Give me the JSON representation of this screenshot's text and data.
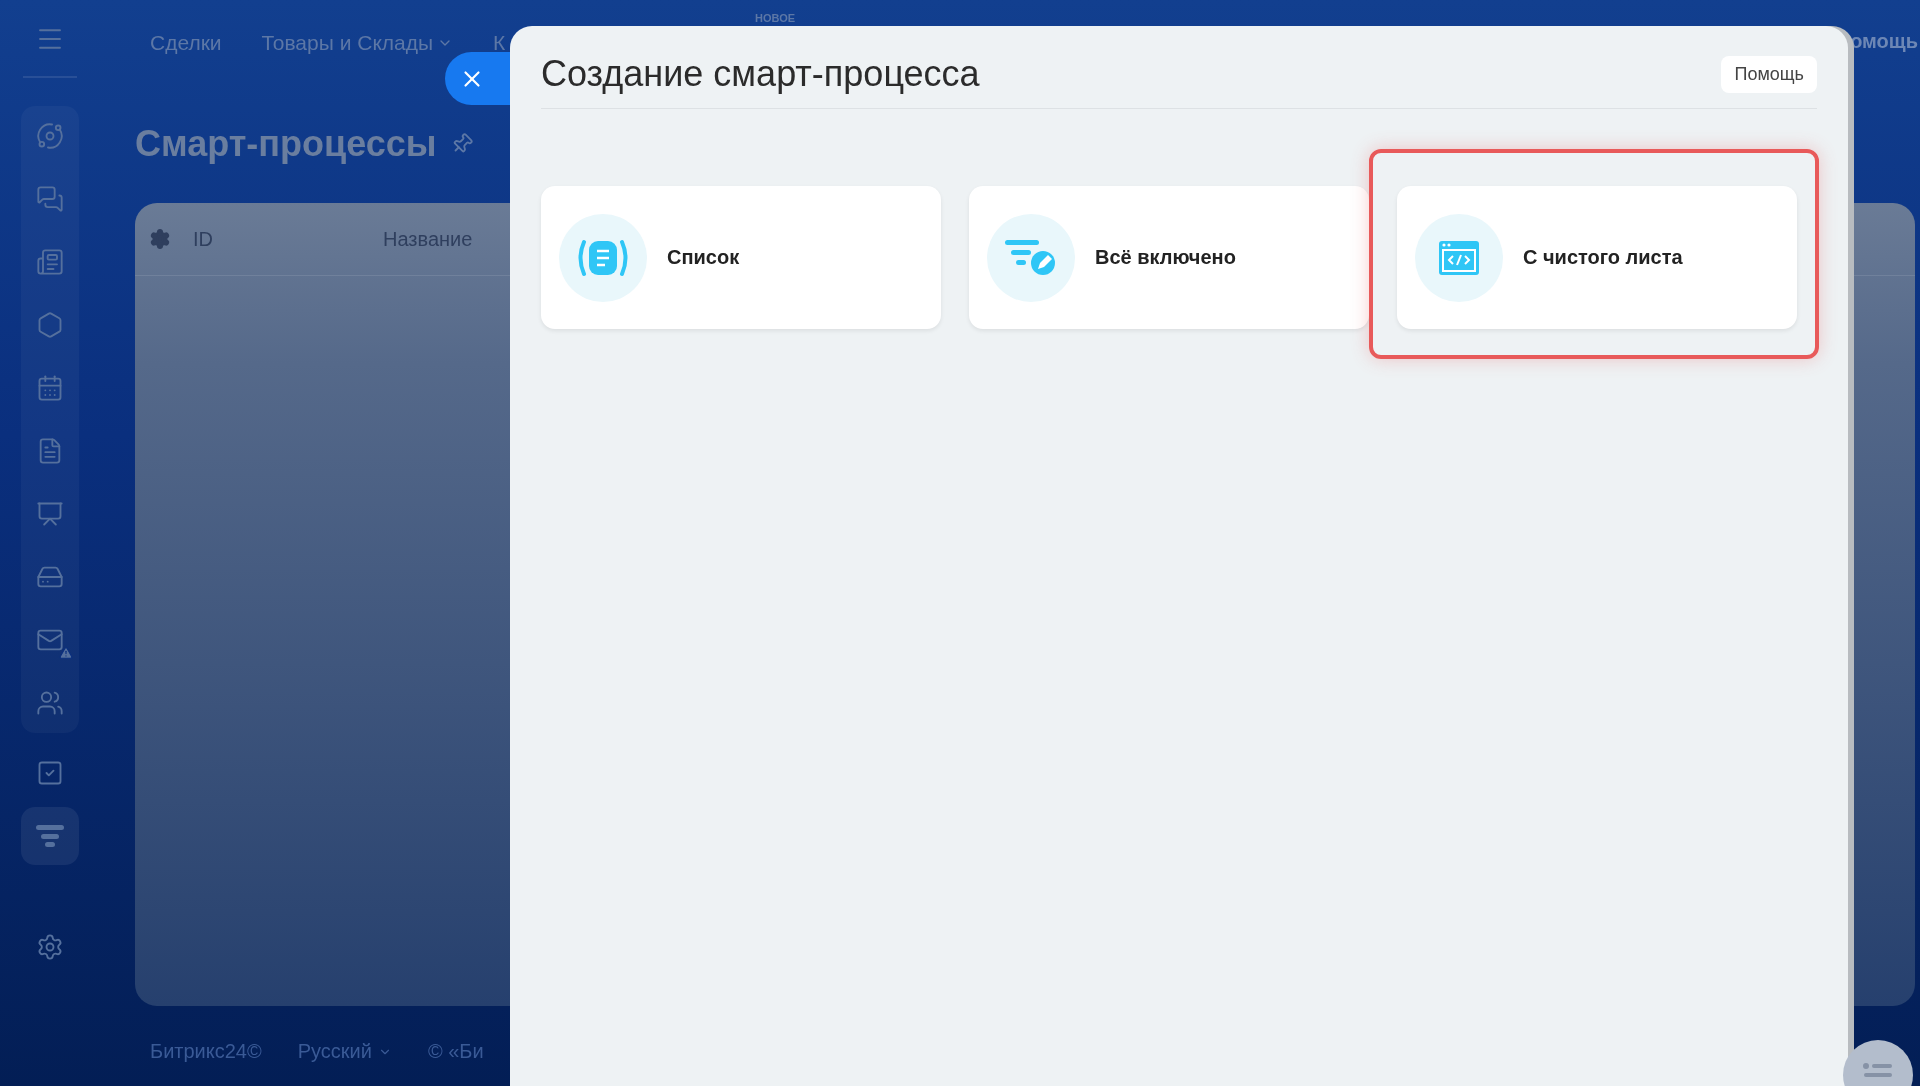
{
  "top_nav": {
    "items": [
      {
        "label": "Сделки",
        "dropdown": false
      },
      {
        "label": "Товары и Склады",
        "dropdown": true
      },
      {
        "label": "К",
        "dropdown": false
      }
    ],
    "badge": "НОВОЕ",
    "help": "омощь"
  },
  "sidebar": {
    "items": [
      {
        "selected": false,
        "warning": false
      },
      {
        "selected": false,
        "warning": false
      },
      {
        "selected": false,
        "warning": false
      },
      {
        "selected": false,
        "warning": false
      },
      {
        "selected": false,
        "warning": false
      },
      {
        "selected": false,
        "warning": false
      },
      {
        "selected": false,
        "warning": false
      },
      {
        "selected": false,
        "warning": false
      },
      {
        "selected": false,
        "warning": true
      },
      {
        "selected": false,
        "warning": false
      },
      {
        "selected": false,
        "warning": false
      },
      {
        "selected": true,
        "warning": false
      },
      {
        "selected": false,
        "warning": false
      }
    ]
  },
  "page": {
    "title": "Смарт-процессы",
    "table": {
      "columns": [
        "ID",
        "Название"
      ]
    }
  },
  "footer": {
    "items": [
      {
        "label": "Битрикс24©",
        "dropdown": false
      },
      {
        "label": "Русский",
        "dropdown": true
      },
      {
        "label": "© «Би",
        "dropdown": false
      }
    ]
  },
  "panel": {
    "title": "Создание смарт-процесса",
    "help_button": "Помощь",
    "cards": [
      {
        "kind": "list",
        "label": "Список",
        "highlighted": false
      },
      {
        "kind": "all",
        "label": "Всё включено",
        "highlighted": false
      },
      {
        "kind": "blank",
        "label": "С чистого листа",
        "highlighted": true
      }
    ]
  }
}
